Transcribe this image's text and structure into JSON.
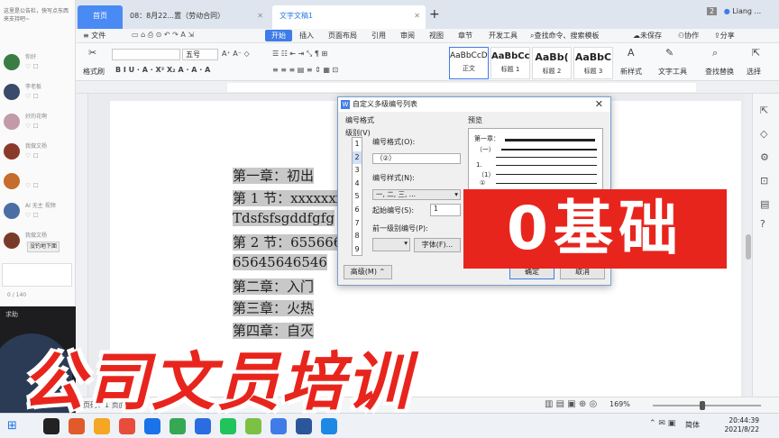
{
  "chat": {
    "notice": "这里是公告栏，快写点东西来支持吧~",
    "messages": [
      {
        "name": "你好",
        "color": "#3a7d44"
      },
      {
        "name": "李老板",
        "color": "#3b4a6b"
      },
      {
        "name": "好的花啊",
        "color": "#c29aa8"
      },
      {
        "name": "我做文杨",
        "color": "#8a3a2a"
      },
      {
        "name": "",
        "color": "#c56d2a"
      },
      {
        "name": "AI 无主 视频",
        "color": "#4a6fa5"
      },
      {
        "name": "我做文杨",
        "color": "#7a3a2a"
      }
    ],
    "follow_button": "没钓地下面",
    "char_count": "0 / 140",
    "cam_label": "求助"
  },
  "tabs": {
    "home": "首页",
    "doc1": "08：8月22...置（劳动合同）",
    "doc2": "文字文稿1",
    "badge": "2",
    "user": "Liang ..."
  },
  "menu": {
    "file": "≡ 文件",
    "items": [
      "开始",
      "插入",
      "页面布局",
      "引用",
      "审阅",
      "视图",
      "章节",
      "开发工具"
    ],
    "search": "查找命令、搜索模板",
    "unsaved": "未保存",
    "collab": "协作",
    "share": "分享"
  },
  "ribbon": {
    "format_painter": "格式刷",
    "font_name": "",
    "font_size": "五号",
    "styles": [
      {
        "preview": "AaBbCcDd",
        "name": "正文"
      },
      {
        "preview": "AaBbCc",
        "name": "标题 1"
      },
      {
        "preview": "AaBb(",
        "name": "标题 2"
      },
      {
        "preview": "AaBbC",
        "name": "标题 3"
      }
    ],
    "new_style": "新样式",
    "text_tools": "文字工具",
    "find_replace": "查找替换",
    "select": "选择"
  },
  "document": {
    "lines": [
      "第一章：初出",
      "第 1 节：xxxxxxxx",
      "Tdsfsfsgddfgfg",
      "第 2 节：6556666",
      "65645646546",
      "第二章：入门",
      "第三章：火热",
      "第四章：自灭"
    ]
  },
  "dialog": {
    "title": "自定义多级编号列表",
    "number_format_group": "编号格式",
    "preview_label": "预览",
    "level_label": "级别(V)",
    "levels": [
      "1",
      "2",
      "3",
      "4",
      "5",
      "6",
      "7",
      "8",
      "9"
    ],
    "format_label": "编号格式(O):",
    "format_value": "（②）",
    "style_label": "编号样式(N):",
    "style_value": "一, 二, 三, ...",
    "start_label": "起始编号(S):",
    "start_value": "1",
    "prev_level_label": "前一级别编号(P):",
    "font_button": "字体(F)...",
    "advanced_button": "高级(M) ⌃",
    "ok_button": "确定",
    "cancel_button": "取消",
    "preview_lines": [
      "第一章：",
      "（一）",
      "1.",
      "（1）",
      "①"
    ]
  },
  "status": {
    "page": "页码：1  页面：2/2",
    "zoom": "169%"
  },
  "taskbar": {
    "lang": "简体",
    "time": "20:44:39",
    "date": "2021/8/22"
  },
  "overlay": {
    "badge": "0基础",
    "title": "公司文员培训"
  },
  "colors": {
    "accent": "#3f7ce8",
    "overlay_red": "#e8251d",
    "tab_home": "#4a8af4"
  }
}
